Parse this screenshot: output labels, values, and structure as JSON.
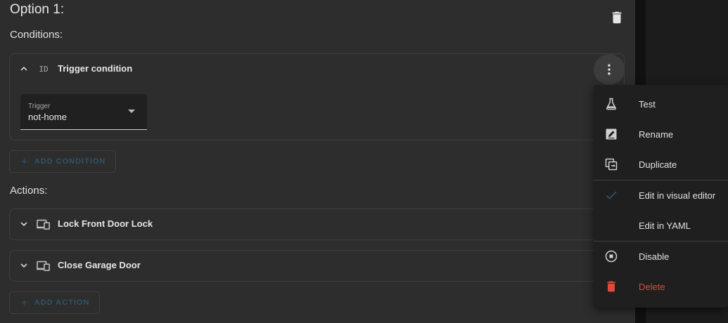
{
  "option": {
    "title": "Option 1:",
    "conditions_label": "Conditions:",
    "actions_label": "Actions:"
  },
  "condition": {
    "icon_text": "ID",
    "title": "Trigger condition",
    "field": {
      "label": "Trigger",
      "value": "not-home"
    }
  },
  "buttons": {
    "add_condition": "ADD CONDITION",
    "add_action": "ADD ACTION",
    "plus": "+"
  },
  "actions": [
    {
      "title": "Lock Front Door Lock",
      "icon": "devices-icon"
    },
    {
      "title": "Close Garage Door",
      "icon": "devices-icon"
    }
  ],
  "menu": {
    "items": [
      {
        "label": "Test",
        "icon": "flask-icon"
      },
      {
        "label": "Rename",
        "icon": "rename-icon"
      },
      {
        "label": "Duplicate",
        "icon": "duplicate-icon"
      },
      {
        "label": "Edit in visual editor",
        "icon": "check-icon",
        "selected": true
      },
      {
        "label": "Edit in YAML",
        "icon": ""
      },
      {
        "label": "Disable",
        "icon": "stop-circle-icon"
      },
      {
        "label": "Delete",
        "icon": "delete-icon",
        "danger": true
      }
    ]
  },
  "colors": {
    "accent": "#2e5566",
    "danger": "#db4c3f",
    "card": "#2d2d2d",
    "menu": "#1f1f1f"
  }
}
